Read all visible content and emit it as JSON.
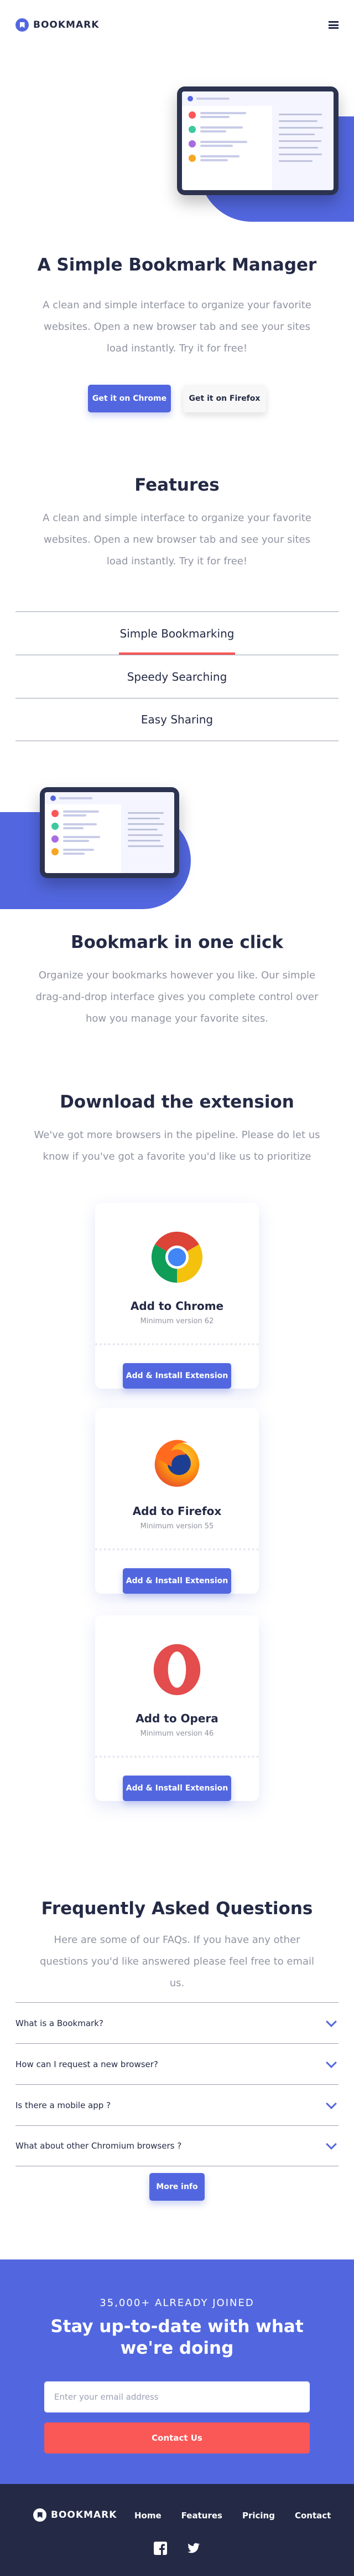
{
  "header": {
    "logo_text": "BOOKMARK",
    "menu_icon": "hamburger-icon"
  },
  "hero": {
    "title": "A Simple Bookmark Manager",
    "text": "A clean and simple interface to organize your favorite websites. Open a new browser tab and see your sites load instantly. Try it for free!",
    "chrome_btn": "Get it on Chrome",
    "firefox_btn": "Get it on Firefox"
  },
  "features": {
    "title": "Features",
    "text": "A clean and simple interface to organize your favorite websites. Open a new browser tab and see your sites load instantly. Try it for free!",
    "tabs": [
      {
        "label": "Simple Bookmarking"
      },
      {
        "label": "Speedy Searching"
      },
      {
        "label": "Easy Sharing"
      }
    ],
    "panel_title": "Bookmark in one click",
    "panel_text": "Organize your bookmarks however you like. Our simple drag-and-drop interface gives you complete control over how you manage your favorite sites."
  },
  "download": {
    "title": "Download the extension",
    "text": "We've got more browsers in the pipeline. Please do let us know if you've got a favorite you'd like us to prioritize",
    "cards": [
      {
        "name": "Add to Chrome",
        "min": "Minimum version 62",
        "button": "Add & Install Extension",
        "icon": "chrome-icon"
      },
      {
        "name": "Add to Firefox",
        "min": "Minimum version 55",
        "button": "Add & Install Extension",
        "icon": "firefox-icon"
      },
      {
        "name": "Add to Opera",
        "min": "Minimum version 46",
        "button": "Add & Install Extension",
        "icon": "opera-icon"
      }
    ]
  },
  "faq": {
    "title": "Frequently Asked Questions",
    "text": "Here are some of our FAQs. If you have any other questions you'd like answered please feel free to email us.",
    "items": [
      {
        "q": "What is a Bookmark?"
      },
      {
        "q": "How can I request a new browser?"
      },
      {
        "q": "Is there a mobile app ?"
      },
      {
        "q": "What about other Chromium browsers ?"
      }
    ],
    "more_btn": "More info"
  },
  "cta": {
    "joined": "35,000+ ALREADY JOINED",
    "title": "Stay up-to-date with what we're doing",
    "email_placeholder": "Enter your email address",
    "button": "Contact Us"
  },
  "footer": {
    "logo_text": "BOOKMARK",
    "nav": [
      "Home",
      "Features",
      "Pricing",
      "Contact"
    ],
    "social": [
      "facebook-icon",
      "twitter-icon"
    ]
  },
  "colors": {
    "primary": "#5267DF",
    "accent": "#FA5757",
    "dark": "#242A45",
    "muted": "#9194A1"
  }
}
